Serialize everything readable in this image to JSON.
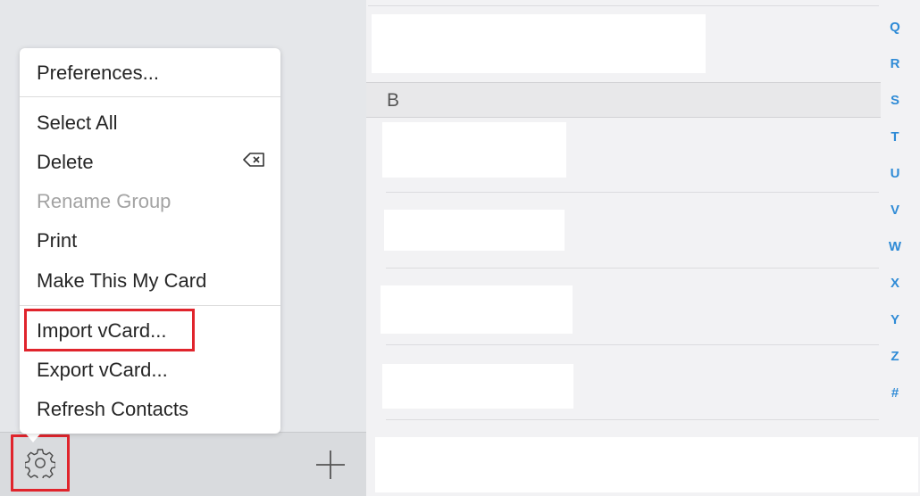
{
  "menu": {
    "items": [
      {
        "label": "Preferences...",
        "enabled": true
      },
      {
        "label": "Select All",
        "enabled": true
      },
      {
        "label": "Delete",
        "enabled": true
      },
      {
        "label": "Rename Group",
        "enabled": false
      },
      {
        "label": "Print",
        "enabled": true
      },
      {
        "label": "Make This My Card",
        "enabled": true
      },
      {
        "label": "Import vCard...",
        "enabled": true,
        "highlighted": true
      },
      {
        "label": "Export vCard...",
        "enabled": true
      },
      {
        "label": "Refresh Contacts",
        "enabled": true
      }
    ],
    "delete_shortcut_icon": "delete-key-icon"
  },
  "toolbar": {
    "settings_icon": "gear-icon",
    "add_icon": "plus-icon"
  },
  "contacts": {
    "section_header": "B"
  },
  "alpha_index": [
    "Q",
    "R",
    "S",
    "T",
    "U",
    "V",
    "W",
    "X",
    "Y",
    "Z",
    "#"
  ],
  "colors": {
    "highlight": "#e0242c",
    "index_accent": "#2f8bd6"
  }
}
